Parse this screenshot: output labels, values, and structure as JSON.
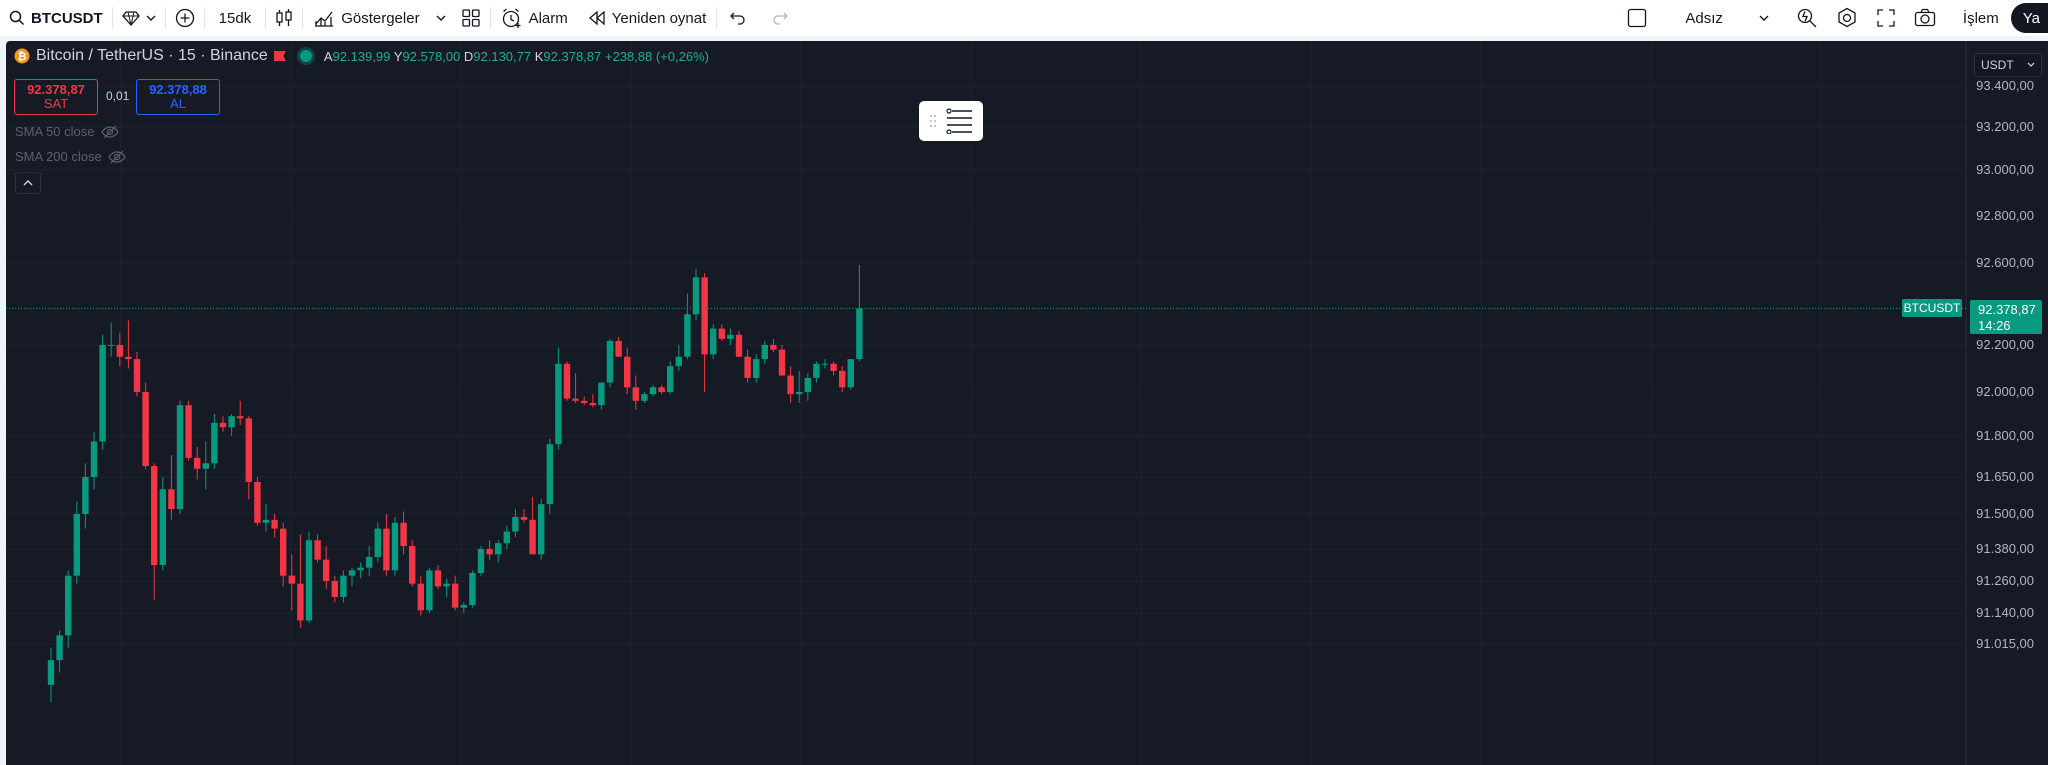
{
  "toolbar": {
    "symbol": "BTCUSDT",
    "interval": "15dk",
    "indicators_label": "Göstergeler",
    "alert_label": "Alarm",
    "replay_label": "Yeniden oynat",
    "layout_name": "Adsız",
    "trade_label": "İşlem",
    "publish_label": "Ya"
  },
  "legend": {
    "title": "Bitcoin / TetherUS · 15 · Binance",
    "open_label": "A",
    "open": "92.139,99",
    "high_label": "Y",
    "high": "92.578,00",
    "low_label": "D",
    "low": "92.130,77",
    "close_label": "K",
    "close": "92.378,87",
    "change": "+238,88 (+0,26%)"
  },
  "trade": {
    "sell_price": "92.378,87",
    "sell_label": "SAT",
    "spread": "0,01",
    "buy_price": "92.378,88",
    "buy_label": "AL"
  },
  "indicators": [
    {
      "label": "SMA 50 close"
    },
    {
      "label": "SMA 200 close"
    }
  ],
  "currency": "USDT",
  "last_price": {
    "symbol": "BTCUSDT",
    "price": "92.378,87",
    "countdown": "14:26"
  },
  "colors": {
    "up": "#089981",
    "down": "#f23645",
    "bg": "#161a25",
    "grid": "#1f2330"
  },
  "chart_data": {
    "type": "candlestick",
    "y_ticks": [
      {
        "value": 93400,
        "label": "93.400,00"
      },
      {
        "value": 93200,
        "label": "93.200,00"
      },
      {
        "value": 93000,
        "label": "93.000,00"
      },
      {
        "value": 92800,
        "label": "92.800,00"
      },
      {
        "value": 92600,
        "label": "92.600,00"
      },
      {
        "value": 92200,
        "label": "92.200,00"
      },
      {
        "value": 92000,
        "label": "92.000,00"
      },
      {
        "value": 91800,
        "label": "91.800,00"
      },
      {
        "value": 91650,
        "label": "91.650,00"
      },
      {
        "value": 91500,
        "label": "91.500,00"
      },
      {
        "value": 91380,
        "label": "91.380,00"
      },
      {
        "value": 91260,
        "label": "91.260,00"
      },
      {
        "value": 91140,
        "label": "91.140,00"
      },
      {
        "value": 91015,
        "label": "91.015,00"
      }
    ],
    "last_price": 92378.87,
    "candles": [
      [
        90850,
        91000,
        90780,
        90950
      ],
      [
        90950,
        91070,
        90900,
        91050
      ],
      [
        91050,
        91300,
        91000,
        91280
      ],
      [
        91280,
        91550,
        91250,
        91500
      ],
      [
        91500,
        91700,
        91450,
        91650
      ],
      [
        91650,
        91820,
        91600,
        91780
      ],
      [
        91780,
        92250,
        91750,
        92200
      ],
      [
        92200,
        92310,
        92150,
        92200
      ],
      [
        92200,
        92260,
        92110,
        92150
      ],
      [
        92150,
        92320,
        92100,
        92140
      ],
      [
        92140,
        92170,
        91980,
        92000
      ],
      [
        92000,
        92040,
        91680,
        91690
      ],
      [
        91690,
        91700,
        91190,
        91320
      ],
      [
        91320,
        91650,
        91300,
        91600
      ],
      [
        91600,
        91730,
        91480,
        91520
      ],
      [
        91520,
        91960,
        91500,
        91940
      ],
      [
        91940,
        91960,
        91710,
        91720
      ],
      [
        91720,
        91760,
        91640,
        91680
      ],
      [
        91680,
        91780,
        91600,
        91700
      ],
      [
        91700,
        91900,
        91680,
        91860
      ],
      [
        91860,
        91890,
        91820,
        91840
      ],
      [
        91840,
        91900,
        91800,
        91890
      ],
      [
        91890,
        91960,
        91850,
        91880
      ],
      [
        91880,
        91890,
        91560,
        91630
      ],
      [
        91630,
        91650,
        91460,
        91470
      ],
      [
        91470,
        91540,
        91440,
        91480
      ],
      [
        91480,
        91500,
        91420,
        91450
      ],
      [
        91450,
        91470,
        91240,
        91280
      ],
      [
        91280,
        91360,
        91150,
        91250
      ],
      [
        91250,
        91430,
        91080,
        91110
      ],
      [
        91110,
        91440,
        91100,
        91410
      ],
      [
        91410,
        91430,
        91330,
        91340
      ],
      [
        91340,
        91390,
        91230,
        91260
      ],
      [
        91260,
        91280,
        91180,
        91200
      ],
      [
        91200,
        91300,
        91180,
        91280
      ],
      [
        91280,
        91310,
        91240,
        91300
      ],
      [
        91300,
        91330,
        91270,
        91310
      ],
      [
        91310,
        91390,
        91280,
        91350
      ],
      [
        91350,
        91470,
        91330,
        91450
      ],
      [
        91450,
        91500,
        91280,
        91300
      ],
      [
        91300,
        91490,
        91280,
        91470
      ],
      [
        91470,
        91510,
        91360,
        91390
      ],
      [
        91390,
        91410,
        91240,
        91250
      ],
      [
        91250,
        91280,
        91130,
        91150
      ],
      [
        91150,
        91310,
        91140,
        91300
      ],
      [
        91300,
        91320,
        91230,
        91240
      ],
      [
        91240,
        91270,
        91200,
        91250
      ],
      [
        91250,
        91280,
        91150,
        91160
      ],
      [
        91160,
        91180,
        91140,
        91170
      ],
      [
        91170,
        91300,
        91160,
        91290
      ],
      [
        91290,
        91390,
        91280,
        91380
      ],
      [
        91380,
        91410,
        91340,
        91360
      ],
      [
        91360,
        91410,
        91330,
        91400
      ],
      [
        91400,
        91460,
        91380,
        91440
      ],
      [
        91440,
        91520,
        91420,
        91490
      ],
      [
        91490,
        91520,
        91470,
        91480
      ],
      [
        91480,
        91570,
        91360,
        91360
      ],
      [
        91360,
        91560,
        91340,
        91540
      ],
      [
        91540,
        91790,
        91500,
        91770
      ],
      [
        91770,
        92190,
        91750,
        92120
      ],
      [
        92120,
        92130,
        91960,
        91970
      ],
      [
        91970,
        92080,
        91950,
        91960
      ],
      [
        91960,
        91980,
        91940,
        91950
      ],
      [
        91950,
        91990,
        91930,
        91940
      ],
      [
        91940,
        92040,
        91920,
        92040
      ],
      [
        92040,
        92230,
        92020,
        92220
      ],
      [
        92220,
        92240,
        92150,
        92150
      ],
      [
        92150,
        92190,
        91990,
        92020
      ],
      [
        92020,
        92070,
        91920,
        91960
      ],
      [
        91960,
        92000,
        91950,
        91990
      ],
      [
        91990,
        92030,
        91980,
        92020
      ],
      [
        92020,
        92030,
        91990,
        92000
      ],
      [
        92000,
        92130,
        91990,
        92110
      ],
      [
        92110,
        92200,
        92090,
        92150
      ],
      [
        92150,
        92450,
        92140,
        92350
      ],
      [
        92350,
        92570,
        92320,
        92530
      ],
      [
        92530,
        92550,
        92000,
        92160
      ],
      [
        92160,
        92300,
        92140,
        92280
      ],
      [
        92280,
        92300,
        92220,
        92230
      ],
      [
        92230,
        92280,
        92200,
        92250
      ],
      [
        92250,
        92270,
        92150,
        92150
      ],
      [
        92150,
        92180,
        92040,
        92060
      ],
      [
        92060,
        92160,
        92040,
        92140
      ],
      [
        92140,
        92220,
        92120,
        92200
      ],
      [
        92200,
        92230,
        92170,
        92180
      ],
      [
        92180,
        92200,
        92070,
        92070
      ],
      [
        92070,
        92110,
        91950,
        91990
      ],
      [
        91990,
        92090,
        91950,
        92000
      ],
      [
        92000,
        92080,
        91960,
        92060
      ],
      [
        92060,
        92130,
        92040,
        92120
      ],
      [
        92120,
        92140,
        92100,
        92120
      ],
      [
        92120,
        92130,
        92070,
        92090
      ],
      [
        92090,
        92110,
        92000,
        92020
      ],
      [
        92020,
        92140,
        92010,
        92140
      ],
      [
        92140,
        92590,
        92130,
        92379
      ]
    ]
  }
}
